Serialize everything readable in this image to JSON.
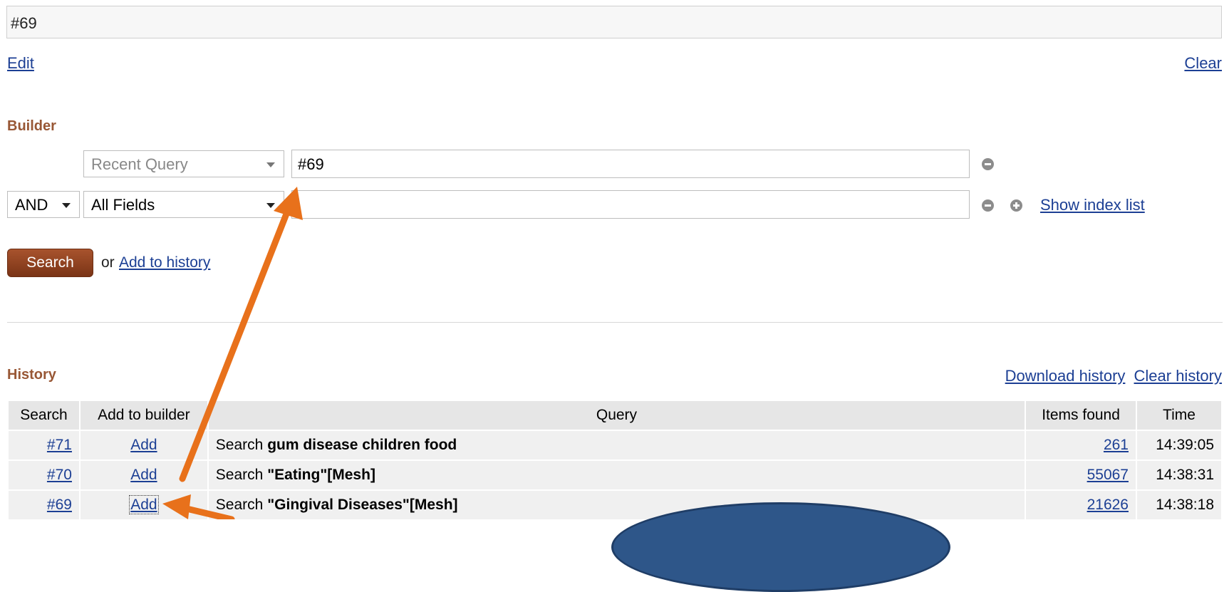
{
  "query_box": {
    "value": "#69"
  },
  "links": {
    "edit": "Edit",
    "clear": "Clear"
  },
  "builder": {
    "heading": "Builder",
    "row1": {
      "field": "Recent Query",
      "term": "#69"
    },
    "row2": {
      "operator": "AND",
      "field": "All Fields",
      "term": "",
      "show_index": "Show index list"
    },
    "search_button": "Search",
    "or_text": "or",
    "add_to_history": "Add to history"
  },
  "history": {
    "heading": "History",
    "download": "Download history",
    "clear": "Clear history",
    "columns": [
      "Search",
      "Add to builder",
      "Query",
      "Items found",
      "Time"
    ],
    "rows": [
      {
        "search": "#71",
        "add": "Add",
        "prefix": "Search",
        "query": "gum disease children food",
        "items": "261",
        "time": "14:39:05"
      },
      {
        "search": "#70",
        "add": "Add",
        "prefix": "Search",
        "query": "\"Eating\"[Mesh]",
        "items": "55067",
        "time": "14:38:31"
      },
      {
        "search": "#69",
        "add": "Add",
        "prefix": "Search",
        "query": "\"Gingival Diseases\"[Mesh]",
        "items": "21626",
        "time": "14:38:18"
      }
    ]
  },
  "colors": {
    "link": "#1c3f94",
    "heading": "#985735",
    "button": "#8b3f1c",
    "arrow": "#e8711b",
    "callout": "#2e5689"
  }
}
